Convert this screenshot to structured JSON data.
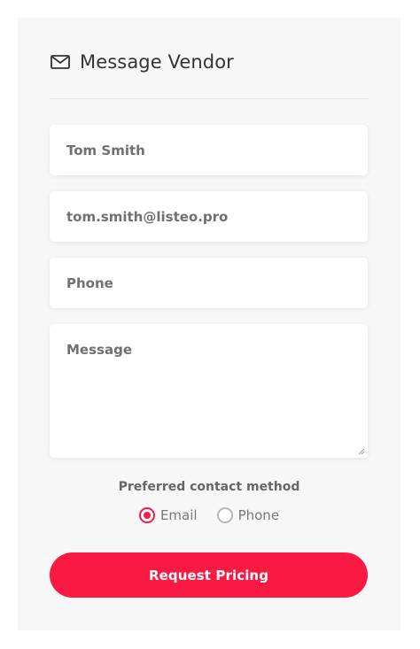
{
  "header": {
    "title": "Message Vendor",
    "icon": "envelope-icon"
  },
  "form": {
    "name_value": "Tom Smith",
    "email_value": "tom.smith@listeo.pro",
    "phone_placeholder": "Phone",
    "message_placeholder": "Message",
    "contact_label": "Preferred contact method",
    "options": [
      {
        "label": "Email",
        "selected": true
      },
      {
        "label": "Phone",
        "selected": false
      }
    ],
    "submit_label": "Request Pricing"
  },
  "colors": {
    "accent": "#f91942",
    "panel_bg": "#f7f7f7"
  }
}
